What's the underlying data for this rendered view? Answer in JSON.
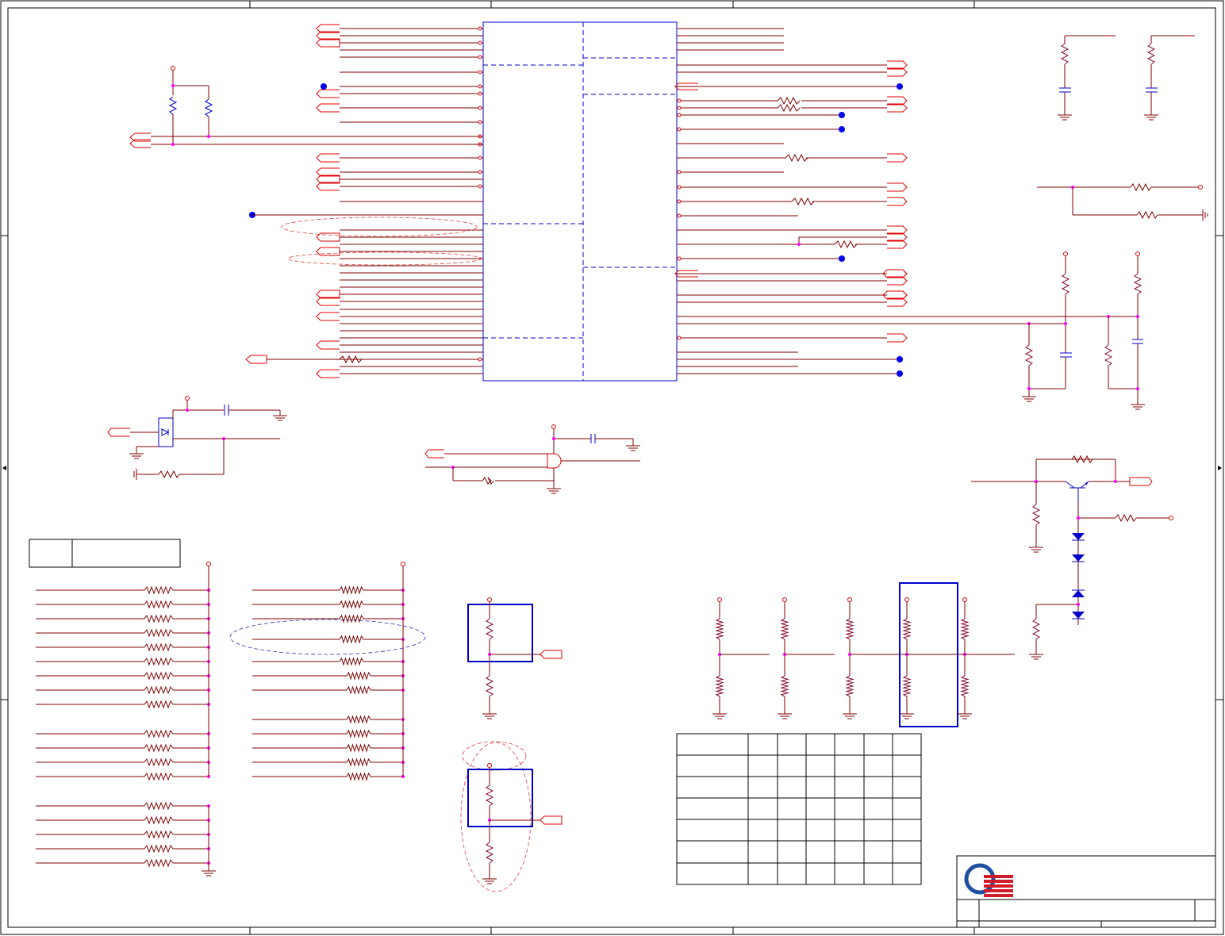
{
  "sheet": {
    "title": "",
    "logo": {
      "name": "company-logo",
      "colors": {
        "ring": "#1f4fa0",
        "stripes": "#d01c2a"
      }
    },
    "colors": {
      "wire": "#800000",
      "symbol": "#e00000",
      "chip": "#0000cc",
      "junction": "#ff00ff",
      "noconnect": "#0000ee"
    }
  },
  "tables": {
    "legend_box": {
      "cells": [
        "",
        ""
      ]
    },
    "option_table": {
      "rows": 7,
      "cols": 7,
      "cells": []
    }
  }
}
